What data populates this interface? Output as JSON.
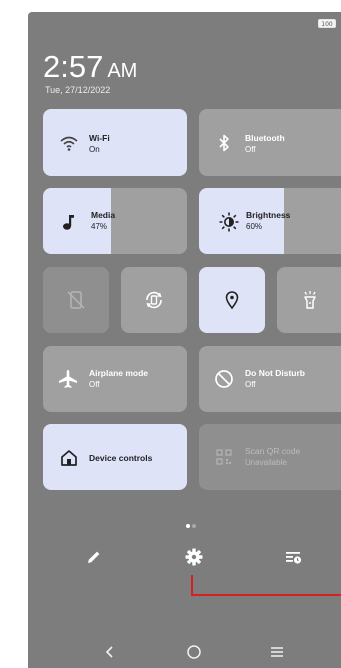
{
  "status": {
    "battery": "100"
  },
  "clock": {
    "time": "2:57",
    "ampm": "AM",
    "date": "Tue, 27/12/2022"
  },
  "tiles": {
    "wifi": {
      "title": "Wi-Fi",
      "status": "On"
    },
    "bluetooth": {
      "title": "Bluetooth",
      "status": "Off"
    },
    "media": {
      "title": "Media",
      "status": "47%",
      "level": 0.47
    },
    "brightness": {
      "title": "Brightness",
      "status": "60%",
      "level": 0.6
    },
    "airplane": {
      "title": "Airplane mode",
      "status": "Off"
    },
    "dnd": {
      "title": "Do Not Disturb",
      "status": "Off"
    },
    "device_controls": {
      "title": "Device controls"
    },
    "scan_qr": {
      "title": "Scan QR code",
      "status": "Unavailable"
    }
  },
  "small_tiles": [
    "screenshot-off-icon",
    "auto-rotate-icon",
    "location-icon",
    "flashlight-icon"
  ],
  "bottom_icons": [
    "edit-icon",
    "settings-icon",
    "power-menu-icon"
  ],
  "nav_icons": [
    "back-icon",
    "home-icon",
    "recents-icon"
  ],
  "colors": {
    "panel": "#7d7d7d",
    "tile_on": "#dfe3f8",
    "tile_off": "#a0a0a0",
    "annotation": "#d62020"
  }
}
